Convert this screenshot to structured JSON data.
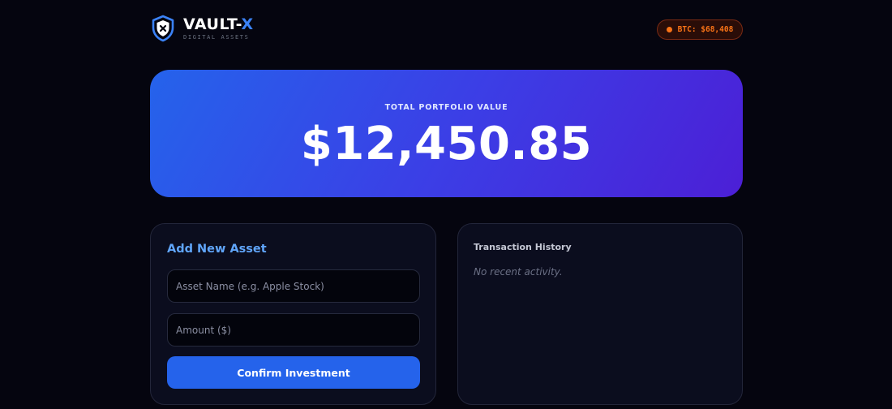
{
  "header": {
    "brand_main": "VAULT-",
    "brand_accent": "X",
    "brand_sub": "DIGITAL ASSETS",
    "ticker": "BTC: $68,408",
    "ticker_icon": "status-dot-icon",
    "logo_icon": "shield-x-icon"
  },
  "portfolio": {
    "label": "TOTAL PORTFOLIO VALUE",
    "value": "$12,450.85"
  },
  "add_asset": {
    "title": "Add New Asset",
    "name_placeholder": "Asset Name (e.g. Apple Stock)",
    "name_value": "",
    "amount_placeholder": "Amount ($)",
    "amount_value": "",
    "confirm_label": "Confirm Investment"
  },
  "history": {
    "title": "Transaction History",
    "empty_text": "No recent activity."
  },
  "colors": {
    "accent": "#3b82f6",
    "button": "#2563eb",
    "ticker": "#f97316",
    "background": "#05050f",
    "card": "#0b0d1e"
  }
}
